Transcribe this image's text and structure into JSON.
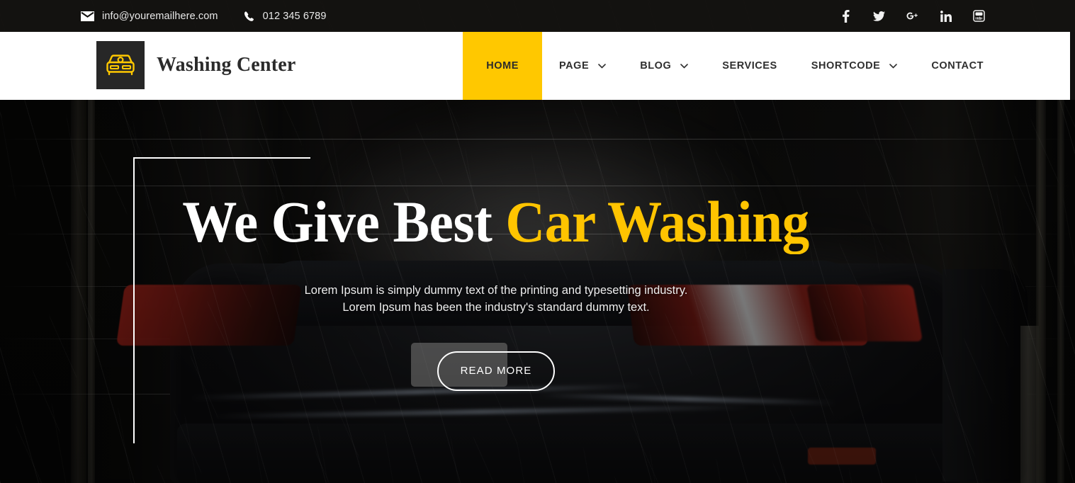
{
  "topbar": {
    "email": "info@youremailhere.com",
    "email_icon": "envelope-icon",
    "phone": "012 345 6789",
    "phone_icon": "phone-icon",
    "socials": [
      {
        "name": "facebook-icon",
        "label": "Facebook"
      },
      {
        "name": "twitter-icon",
        "label": "Twitter"
      },
      {
        "name": "google-plus-icon",
        "label": "Google Plus"
      },
      {
        "name": "linkedin-icon",
        "label": "LinkedIn"
      },
      {
        "name": "youtube-icon",
        "label": "YouTube"
      }
    ]
  },
  "header": {
    "brand_name": "Washing Center",
    "brand_icon": "car-icon",
    "nav": [
      {
        "label": "HOME",
        "active": true,
        "has_dropdown": false
      },
      {
        "label": "PAGE",
        "active": false,
        "has_dropdown": true
      },
      {
        "label": "BLOG",
        "active": false,
        "has_dropdown": true
      },
      {
        "label": "SERVICES",
        "active": false,
        "has_dropdown": false
      },
      {
        "label": "SHORTCODE",
        "active": false,
        "has_dropdown": true
      },
      {
        "label": "CONTACT",
        "active": false,
        "has_dropdown": false
      }
    ]
  },
  "hero": {
    "title_white": "We Give Best ",
    "title_accent": "Car Washing",
    "subtitle_line1": "Lorem Ipsum is simply dummy text of the printing and typesetting industry.",
    "subtitle_line2": "Lorem Ipsum has been the industry's standard dummy text.",
    "cta_label": "READ MORE"
  },
  "colors": {
    "accent_yellow": "#FFC800",
    "title_accent": "#FFC400",
    "topbar_bg": "#141311",
    "header_bg": "#FFFFFF",
    "nav_text": "#2F2F2F",
    "brand_mark_bg": "#272727"
  }
}
